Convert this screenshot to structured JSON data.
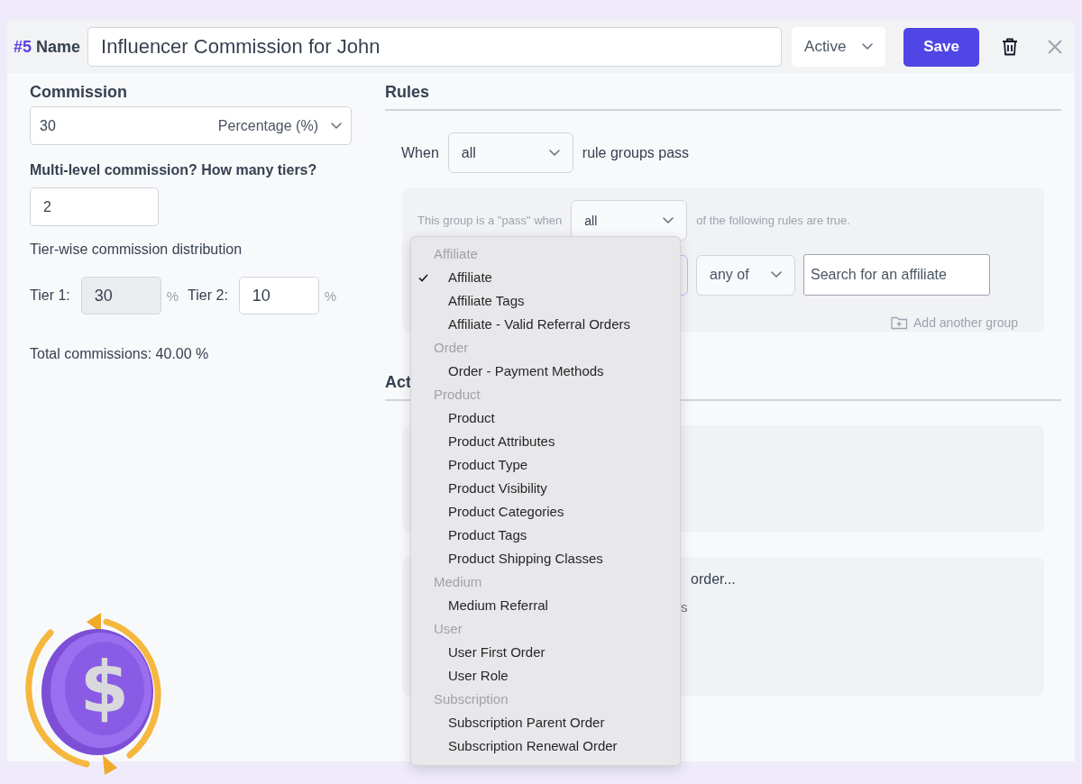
{
  "header": {
    "number": "#5",
    "label": "Name",
    "name_value": "Influencer Commission for John",
    "status": "Active",
    "save": "Save"
  },
  "commission": {
    "label": "Commission",
    "value": "30",
    "type": "Percentage (%)"
  },
  "multilevel": {
    "label": "Multi-level commission? How many tiers?",
    "value": "2"
  },
  "distribution": {
    "label": "Tier-wise commission distribution",
    "tiers": [
      {
        "label": "Tier 1:",
        "value": "30",
        "unit": "%",
        "disabled": true
      },
      {
        "label": "Tier 2:",
        "value": "10",
        "unit": "%",
        "disabled": false
      }
    ]
  },
  "total": "Total commissions: 40.00 %",
  "rules": {
    "title": "Rules",
    "when": "When",
    "match": "all",
    "suffix": "rule groups pass",
    "group": {
      "prefix": "This group is a \"pass\" when",
      "match": "all",
      "suffix": "of the following rules are true.",
      "operator": "any of",
      "search_placeholder": "Search for an affiliate"
    },
    "add_group": "Add another group"
  },
  "actions": {
    "title": "Act",
    "texts": [
      "order...",
      "s"
    ]
  },
  "dropdown": {
    "groups": [
      {
        "label": "Affiliate",
        "options": [
          {
            "label": "Affiliate",
            "selected": true
          },
          {
            "label": "Affiliate Tags",
            "selected": false
          },
          {
            "label": "Affiliate - Valid Referral Orders",
            "selected": false
          }
        ]
      },
      {
        "label": "Order",
        "options": [
          {
            "label": "Order - Payment Methods",
            "selected": false
          }
        ]
      },
      {
        "label": "Product",
        "options": [
          {
            "label": "Product",
            "selected": false
          },
          {
            "label": "Product Attributes",
            "selected": false
          },
          {
            "label": "Product Type",
            "selected": false
          },
          {
            "label": "Product Visibility",
            "selected": false
          },
          {
            "label": "Product Categories",
            "selected": false
          },
          {
            "label": "Product Tags",
            "selected": false
          },
          {
            "label": "Product Shipping Classes",
            "selected": false
          }
        ]
      },
      {
        "label": "Medium",
        "options": [
          {
            "label": "Medium Referral",
            "selected": false
          }
        ]
      },
      {
        "label": "User",
        "options": [
          {
            "label": "User First Order",
            "selected": false
          },
          {
            "label": "User Role",
            "selected": false
          }
        ]
      },
      {
        "label": "Subscription",
        "options": [
          {
            "label": "Subscription Parent Order",
            "selected": false
          },
          {
            "label": "Subscription Renewal Order",
            "selected": false
          }
        ]
      }
    ]
  },
  "coin_symbol": "$"
}
